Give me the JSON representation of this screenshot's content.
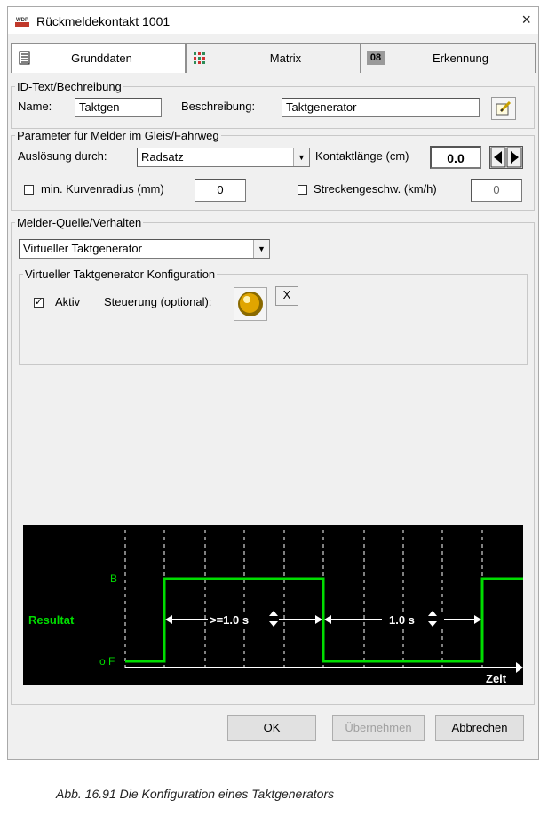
{
  "window": {
    "title": "Rückmeldekontakt 1001",
    "close_label": "×"
  },
  "tabs": [
    {
      "label": "Grunddaten",
      "icon": "document-icon"
    },
    {
      "label": "Matrix",
      "icon": "matrix-grid-icon"
    },
    {
      "label": "Erkennung",
      "icon": "08"
    }
  ],
  "id_section": {
    "legend": "ID-Text/Bechreibung",
    "name_label": "Name:",
    "name_value": "Taktgen",
    "desc_label": "Beschreibung:",
    "desc_value": "Taktgenerator",
    "edit_icon": "edit-note-icon"
  },
  "param_section": {
    "legend": "Parameter für Melder im Gleis/Fahrweg",
    "trigger_label": "Auslösung durch:",
    "trigger_value": "Radsatz",
    "contact_label": "Kontaktlänge (cm)",
    "contact_value": "0.0",
    "curve_label": "min. Kurvenradius (mm)",
    "curve_value": "0",
    "speed_label": "Streckengeschw. (km/h)",
    "speed_value": "0"
  },
  "source_section": {
    "legend": "Melder-Quelle/Verhalten",
    "source_value": "Virtueller Taktgenerator",
    "config_legend": "Virtueller Taktgenerator Konfiguration",
    "active_label": "Aktiv",
    "control_label": "Steuerung (optional):",
    "clear_label": "X"
  },
  "diagram": {
    "label_b": "B",
    "label_f": "o F",
    "result_label": "Resultat",
    "interval1": ">=1.0 s",
    "interval2": "1.0 s",
    "time_label": "Zeit"
  },
  "buttons": {
    "ok": "OK",
    "apply": "Übernehmen",
    "cancel": "Abbrechen"
  },
  "caption": "Abb. 16.91  Die Konfiguration eines Taktgenerators",
  "colors": {
    "signal_green": "#00dd00",
    "diagram_bg": "#000000",
    "text_white": "#ffffff"
  }
}
